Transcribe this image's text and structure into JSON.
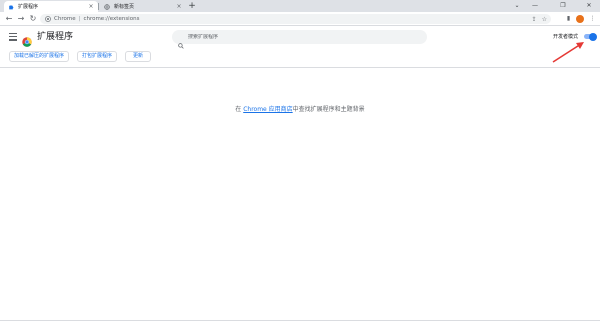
{
  "tabs": [
    {
      "title": "扩展程序",
      "active": true,
      "icon": "puzzle-icon"
    },
    {
      "title": "新标签页",
      "active": false,
      "icon": "globe-icon"
    }
  ],
  "window_controls": {
    "minimize": "—",
    "maximize": "❐",
    "close": "✕",
    "tab_search": "⌄"
  },
  "omnibox": {
    "site_label": "Chrome",
    "url": "chrome://extensions"
  },
  "header": {
    "title": "扩展程序",
    "search_placeholder": "搜索扩展程序",
    "dev_mode_label": "开发者模式",
    "dev_mode_on": true
  },
  "dev_buttons": {
    "load_unpacked": "加载已解压的扩展程序",
    "pack": "打包扩展程序",
    "update": "更新"
  },
  "empty_state": {
    "prefix": "在 ",
    "link": "Chrome 应用商店",
    "suffix": "中查找扩展程序和主题背景"
  },
  "colors": {
    "accent": "#1a73e8",
    "annotation_arrow": "#e53935"
  }
}
